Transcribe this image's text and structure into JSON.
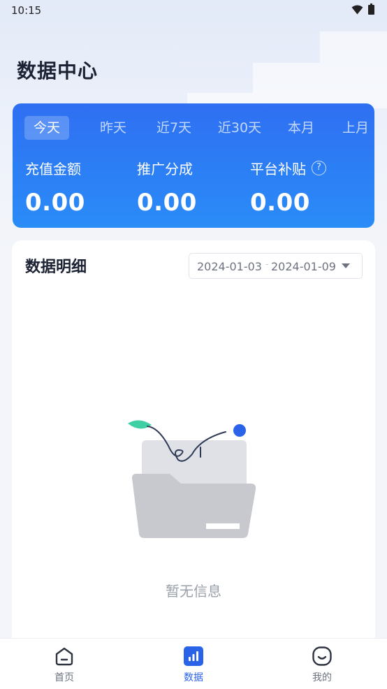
{
  "status_bar": {
    "time": "10:15",
    "wifi_icon": "wifi-icon",
    "battery_icon": "battery-icon"
  },
  "page": {
    "title": "数据中心"
  },
  "summary": {
    "tabs": [
      {
        "label": "今天",
        "active": true
      },
      {
        "label": "昨天",
        "active": false
      },
      {
        "label": "近7天",
        "active": false
      },
      {
        "label": "近30天",
        "active": false
      },
      {
        "label": "本月",
        "active": false
      },
      {
        "label": "上月",
        "active": false
      }
    ],
    "metrics": [
      {
        "label": "充值金额",
        "value": "0.00"
      },
      {
        "label": "推广分成",
        "value": "0.00"
      },
      {
        "label": "平台补贴",
        "value": "0.00",
        "help_icon": "question-mark-icon"
      }
    ],
    "help_glyph": "?"
  },
  "detail": {
    "title": "数据明细",
    "date_start": "2024-01-03",
    "date_separator": "-",
    "date_end": "2024-01-09",
    "empty_text": "暂无信息"
  },
  "bottom_nav": [
    {
      "label": "首页",
      "icon": "home-icon",
      "active": false
    },
    {
      "label": "数据",
      "icon": "bar-chart-icon",
      "active": true
    },
    {
      "label": "我的",
      "icon": "smiley-face-icon",
      "active": false
    }
  ],
  "colors": {
    "accent": "#2a62e8",
    "card_gradient_start": "#2f6ff2",
    "card_gradient_end": "#2a8cf7",
    "leaf": "#3fcfa4"
  }
}
